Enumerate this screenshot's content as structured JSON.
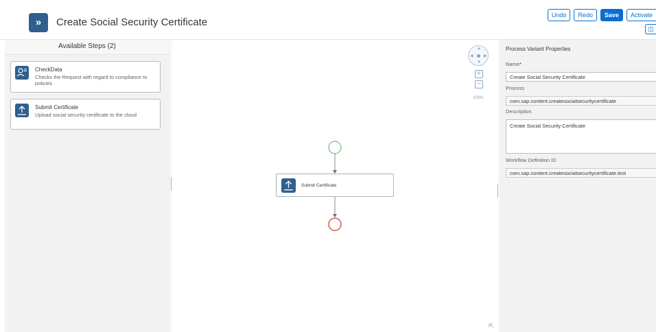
{
  "header": {
    "title": "Create Social Security Certificate",
    "app_icon": "double-chevron-right-icon",
    "toolbar": {
      "undo_label": "Undo",
      "redo_label": "Redo",
      "save_label": "Save",
      "activate_label": "Activate"
    }
  },
  "left_panel": {
    "title": "Available Steps (2)",
    "steps": [
      {
        "name": "CheckData",
        "description": "Checks the Request with regard to compliance to policies",
        "icon": "user-check-icon"
      },
      {
        "name": "Submit Certificate",
        "description": "Upload social security certificate to the cloud",
        "icon": "upload-icon"
      }
    ]
  },
  "canvas": {
    "zoom_level": "100%",
    "task": {
      "label": "Submit Certificate",
      "icon": "upload-icon"
    },
    "colors": {
      "start_event": "#4caf50",
      "end_event": "#d32f2f",
      "accent": "#2f5f8f"
    }
  },
  "properties": {
    "title": "Process Variant Properties",
    "name_label": "Name",
    "name_required_marker": "*",
    "name_value": "Create Social Security Certificate",
    "process_label": "Process",
    "process_value": "com.sap.content.createsocialsecuritycertificate",
    "description_label": "Description",
    "description_value": "Create Social Security Certificate",
    "workflow_label": "Workflow Definition ID",
    "workflow_value": "com.sap.content.createsocialsecuritycertificate.test"
  }
}
